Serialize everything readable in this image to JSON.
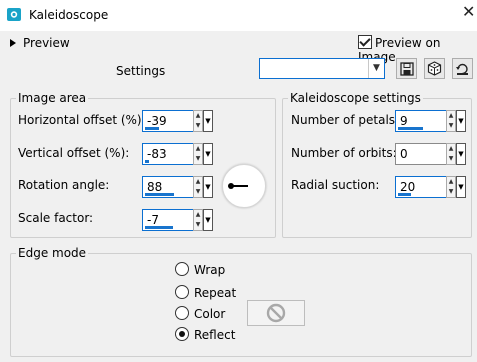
{
  "window": {
    "title": "Kaleidoscope",
    "close_glyph": "✕"
  },
  "header": {
    "preview_toggle_label": "Preview",
    "preview_on_image_label": "Preview on Image",
    "preview_on_image_checked": true
  },
  "settings": {
    "label": "Settings",
    "preset_value": ""
  },
  "image_area": {
    "title": "Image area",
    "fields": [
      {
        "label": "Horizontal offset (%):",
        "value": "-39",
        "level": 0.3
      },
      {
        "label": "Vertical offset (%):",
        "value": "-83",
        "level": 0.08
      },
      {
        "label": "Rotation angle:",
        "value": "88",
        "level": 0.62
      },
      {
        "label": "Scale factor:",
        "value": "-7",
        "level": 0.6
      }
    ]
  },
  "kaleidoscope_settings": {
    "title": "Kaleidoscope settings",
    "fields": [
      {
        "label": "Number of petals:",
        "value": "9",
        "level": 0.55
      },
      {
        "label": "Number of orbits:",
        "value": "0",
        "level": 0.0
      },
      {
        "label": "Radial suction:",
        "value": "20",
        "level": 0.28
      }
    ]
  },
  "edge_mode": {
    "title": "Edge mode",
    "options": [
      "Wrap",
      "Repeat",
      "Color",
      "Reflect"
    ],
    "selected": "Reflect"
  },
  "icons": {
    "app": "kaleidoscope-app-icon",
    "save": "save-icon",
    "randomize": "dice-icon",
    "reset": "reset-icon",
    "color_disabled": "no-symbol-icon"
  },
  "colors": {
    "accent": "#0b6fd1",
    "slider_bar": "#1874cd",
    "app_icon": "#1aa3c8"
  }
}
